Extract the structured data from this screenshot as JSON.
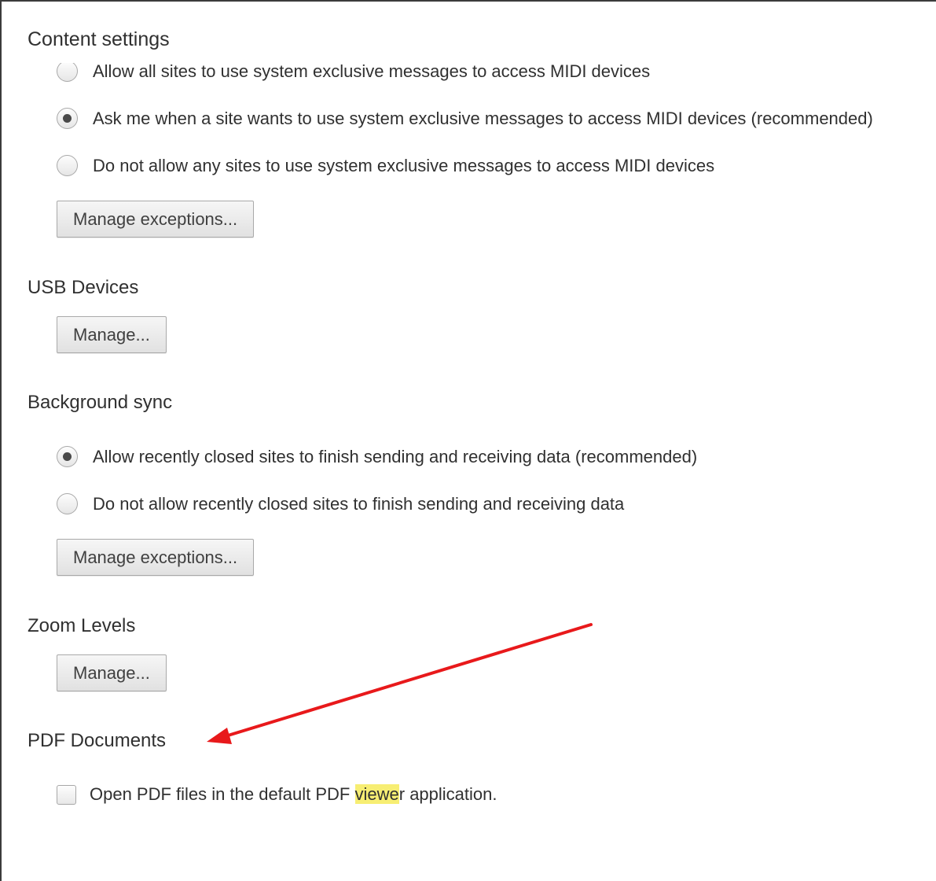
{
  "page": {
    "title": "Content settings"
  },
  "midi": {
    "options": [
      {
        "label": "Allow all sites to use system exclusive messages to access MIDI devices",
        "selected": false
      },
      {
        "label": "Ask me when a site wants to use system exclusive messages to access MIDI devices (recommended)",
        "selected": true
      },
      {
        "label": "Do not allow any sites to use system exclusive messages to access MIDI devices",
        "selected": false
      }
    ],
    "button_label": "Manage exceptions..."
  },
  "usb": {
    "title": "USB Devices",
    "button_label": "Manage..."
  },
  "background_sync": {
    "title": "Background sync",
    "options": [
      {
        "label": "Allow recently closed sites to finish sending and receiving data (recommended)",
        "selected": true
      },
      {
        "label": "Do not allow recently closed sites to finish sending and receiving data",
        "selected": false
      }
    ],
    "button_label": "Manage exceptions..."
  },
  "zoom": {
    "title": "Zoom Levels",
    "button_label": "Manage..."
  },
  "pdf": {
    "title": "PDF Documents",
    "checkbox_checked": false,
    "label_before": "Open PDF files in the default PDF ",
    "label_highlight": "viewe",
    "label_after": "r application."
  },
  "annotation": {
    "arrow_color": "#e8191b",
    "highlight_color": "#f7ee73"
  }
}
